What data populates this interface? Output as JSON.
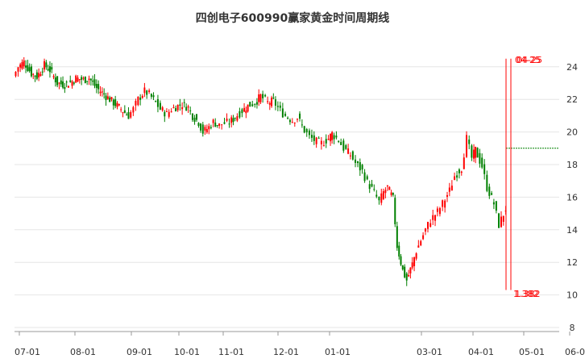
{
  "chart_data": {
    "type": "candlestick",
    "title": "四创电子600990赢家黄金时间周期线",
    "xlabel": "",
    "ylabel": "",
    "ylim": [
      8,
      25
    ],
    "grid": true,
    "colors": {
      "up": "#ff0000",
      "down": "#008000",
      "grid": "#e6e6e6",
      "axis": "#333333",
      "hline": "#008000"
    },
    "x_ticks": [
      "07-01",
      "08-01",
      "09-01",
      "10-01",
      "11-01",
      "12-01",
      "01-01",
      "03-01",
      "04-01",
      "05-01",
      "06-01"
    ],
    "y_ticks": [
      "8",
      "10",
      "12",
      "14",
      "16",
      "18",
      "20",
      "22",
      "24"
    ],
    "close_series": [
      {
        "date": "06-28",
        "value": 23.4
      },
      {
        "date": "07-01",
        "value": 24.0
      },
      {
        "date": "07-04",
        "value": 24.3
      },
      {
        "date": "07-08",
        "value": 23.6
      },
      {
        "date": "07-11",
        "value": 23.4
      },
      {
        "date": "07-15",
        "value": 24.1
      },
      {
        "date": "07-18",
        "value": 23.8
      },
      {
        "date": "07-22",
        "value": 23.0
      },
      {
        "date": "07-26",
        "value": 22.9
      },
      {
        "date": "07-30",
        "value": 23.1
      },
      {
        "date": "08-02",
        "value": 23.3
      },
      {
        "date": "08-06",
        "value": 23.2
      },
      {
        "date": "08-09",
        "value": 23.3
      },
      {
        "date": "08-13",
        "value": 22.7
      },
      {
        "date": "08-16",
        "value": 22.4
      },
      {
        "date": "08-20",
        "value": 22.0
      },
      {
        "date": "08-23",
        "value": 21.7
      },
      {
        "date": "08-27",
        "value": 21.3
      },
      {
        "date": "08-30",
        "value": 21.0
      },
      {
        "date": "09-03",
        "value": 21.4
      },
      {
        "date": "09-06",
        "value": 22.0
      },
      {
        "date": "09-10",
        "value": 22.5
      },
      {
        "date": "09-13",
        "value": 22.3
      },
      {
        "date": "09-17",
        "value": 21.8
      },
      {
        "date": "09-20",
        "value": 21.4
      },
      {
        "date": "09-24",
        "value": 21.1
      },
      {
        "date": "09-27",
        "value": 21.4
      },
      {
        "date": "10-01",
        "value": 21.6
      },
      {
        "date": "10-04",
        "value": 21.7
      },
      {
        "date": "10-08",
        "value": 21.5
      },
      {
        "date": "10-11",
        "value": 21.0
      },
      {
        "date": "10-15",
        "value": 20.6
      },
      {
        "date": "10-18",
        "value": 20.0
      },
      {
        "date": "10-22",
        "value": 20.3
      },
      {
        "date": "10-25",
        "value": 20.6
      },
      {
        "date": "10-29",
        "value": 20.4
      },
      {
        "date": "11-01",
        "value": 20.5
      },
      {
        "date": "11-05",
        "value": 20.6
      },
      {
        "date": "11-08",
        "value": 20.9
      },
      {
        "date": "11-12",
        "value": 21.3
      },
      {
        "date": "11-15",
        "value": 21.6
      },
      {
        "date": "11-19",
        "value": 21.8
      },
      {
        "date": "11-22",
        "value": 22.2
      },
      {
        "date": "11-26",
        "value": 21.8
      },
      {
        "date": "11-29",
        "value": 21.9
      },
      {
        "date": "12-03",
        "value": 21.3
      },
      {
        "date": "12-06",
        "value": 21.0
      },
      {
        "date": "12-10",
        "value": 20.7
      },
      {
        "date": "12-13",
        "value": 20.9
      },
      {
        "date": "12-17",
        "value": 20.1
      },
      {
        "date": "12-20",
        "value": 19.7
      },
      {
        "date": "12-24",
        "value": 19.4
      },
      {
        "date": "12-27",
        "value": 19.3
      },
      {
        "date": "12-31",
        "value": 19.6
      },
      {
        "date": "01-03",
        "value": 19.9
      },
      {
        "date": "01-07",
        "value": 19.5
      },
      {
        "date": "01-10",
        "value": 19.0
      },
      {
        "date": "01-14",
        "value": 18.6
      },
      {
        "date": "01-17",
        "value": 18.1
      },
      {
        "date": "01-21",
        "value": 17.6
      },
      {
        "date": "01-24",
        "value": 16.9
      },
      {
        "date": "01-28",
        "value": 16.3
      },
      {
        "date": "01-31",
        "value": 15.7
      },
      {
        "date": "02-04",
        "value": 16.3
      },
      {
        "date": "02-07",
        "value": 16.6
      },
      {
        "date": "02-11",
        "value": 15.9
      },
      {
        "date": "02-14",
        "value": 13.0
      },
      {
        "date": "02-18",
        "value": 11.5
      },
      {
        "date": "02-21",
        "value": 10.9
      },
      {
        "date": "02-25",
        "value": 11.9
      },
      {
        "date": "02-28",
        "value": 12.7
      },
      {
        "date": "03-04",
        "value": 14.0
      },
      {
        "date": "03-07",
        "value": 14.6
      },
      {
        "date": "03-11",
        "value": 15.1
      },
      {
        "date": "03-14",
        "value": 15.6
      },
      {
        "date": "03-18",
        "value": 16.4
      },
      {
        "date": "03-21",
        "value": 17.3
      },
      {
        "date": "03-25",
        "value": 17.8
      },
      {
        "date": "03-28",
        "value": 19.6
      },
      {
        "date": "03-31",
        "value": 18.4
      },
      {
        "date": "04-03",
        "value": 18.9
      },
      {
        "date": "04-07",
        "value": 17.9
      },
      {
        "date": "04-10",
        "value": 16.6
      },
      {
        "date": "04-14",
        "value": 15.6
      },
      {
        "date": "04-17",
        "value": 14.3
      },
      {
        "date": "04-21",
        "value": 15.3
      }
    ],
    "annotations": {
      "vertical_lines": [
        {
          "date": "04-25",
          "top_label": "04-25",
          "bottom_label": "1.382",
          "y_top": 24.5,
          "y_bottom": 10.3
        },
        {
          "date": "04-26",
          "top_label": "04-25",
          "bottom_label": "1.382",
          "y_top": 24.5,
          "y_bottom": 10.3
        }
      ],
      "horizontal_line": {
        "value": 19.0,
        "from_date": "04-26"
      }
    }
  }
}
